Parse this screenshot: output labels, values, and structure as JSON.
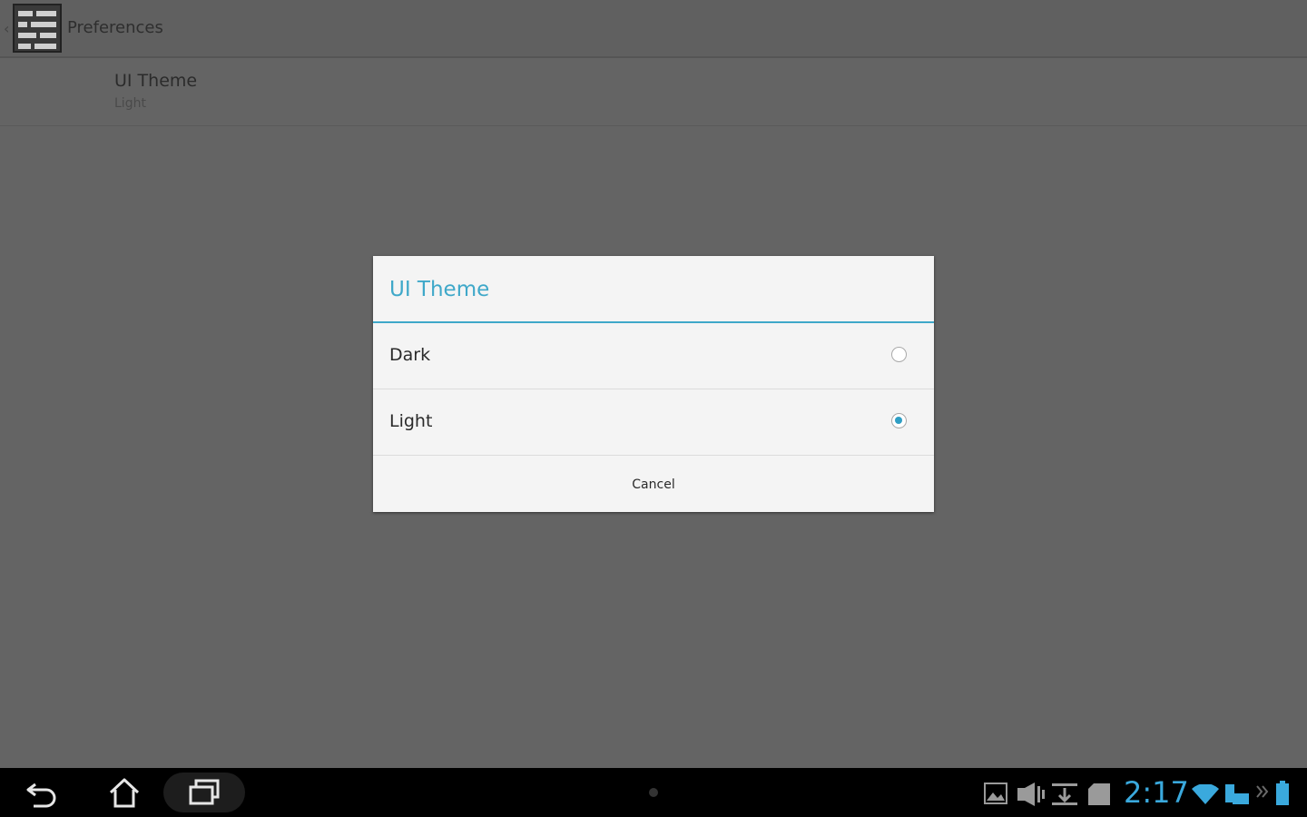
{
  "actionbar": {
    "title": "Preferences",
    "back_caret": "‹"
  },
  "preference": {
    "title": "UI Theme",
    "summary": "Light"
  },
  "dialog": {
    "title": "UI Theme",
    "accent_color": "#3fa8c9",
    "options": [
      {
        "label": "Dark",
        "checked": false
      },
      {
        "label": "Light",
        "checked": true
      }
    ],
    "cancel_label": "Cancel"
  },
  "navbar": {
    "buttons": [
      "back-icon",
      "home-icon",
      "recent-apps-icon"
    ],
    "clock": "2:17",
    "tray_icons": [
      "gallery-icon",
      "media-icon",
      "download-icon",
      "sd-card-icon",
      "wifi-icon",
      "keyboard-icon",
      "more-icon",
      "battery-icon"
    ]
  }
}
